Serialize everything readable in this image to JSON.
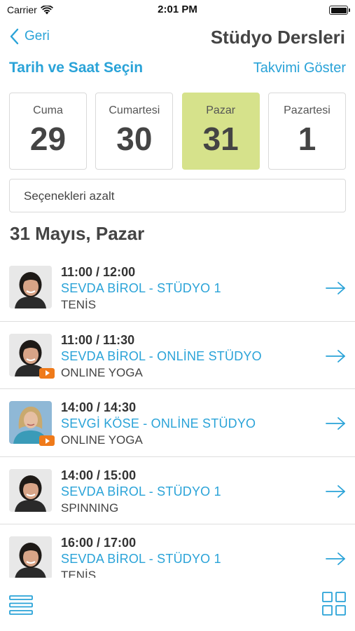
{
  "status_bar": {
    "carrier": "Carrier",
    "time": "2:01 PM"
  },
  "nav": {
    "back_label": "Geri",
    "title": "Stüdyo Dersleri"
  },
  "subheader": {
    "title": "Tarih ve Saat Seçin",
    "calendar_link": "Takvimi Göster"
  },
  "days": [
    {
      "name": "Cuma",
      "number": "29",
      "selected": false
    },
    {
      "name": "Cumartesi",
      "number": "30",
      "selected": false
    },
    {
      "name": "Pazar",
      "number": "31",
      "selected": true
    },
    {
      "name": "Pazartesi",
      "number": "1",
      "selected": false
    }
  ],
  "filter": {
    "label": "Seçenekleri azalt"
  },
  "date_heading": "31 Mayıs, Pazar",
  "classes": [
    {
      "time": "11:00 / 12:00",
      "instructor": "SEVDA BİROL - STÜDYO 1",
      "type": "TENİS",
      "online": false
    },
    {
      "time": "11:00 / 11:30",
      "instructor": "SEVDA BİROL - ONLİNE STÜDYO",
      "type": "ONLINE YOGA",
      "online": true
    },
    {
      "time": "14:00 / 14:30",
      "instructor": "SEVGİ KÖSE - ONLİNE STÜDYO",
      "type": "ONLINE YOGA",
      "online": true
    },
    {
      "time": "14:00 / 15:00",
      "instructor": "SEVDA BİROL - STÜDYO 1",
      "type": "SPINNING",
      "online": false
    },
    {
      "time": "16:00 / 17:00",
      "instructor": "SEVDA BİROL - STÜDYO 1",
      "type": "TENİS",
      "online": false
    }
  ],
  "colors": {
    "accent": "#2aa3d8",
    "selected_day": "#d6e28b",
    "video_badge": "#ef7a1a"
  },
  "icons": {
    "back": "chevron-left-icon",
    "row": "arrow-right-icon",
    "list_view": "list-view-icon",
    "grid_view": "grid-view-icon",
    "video": "video-play-icon"
  }
}
